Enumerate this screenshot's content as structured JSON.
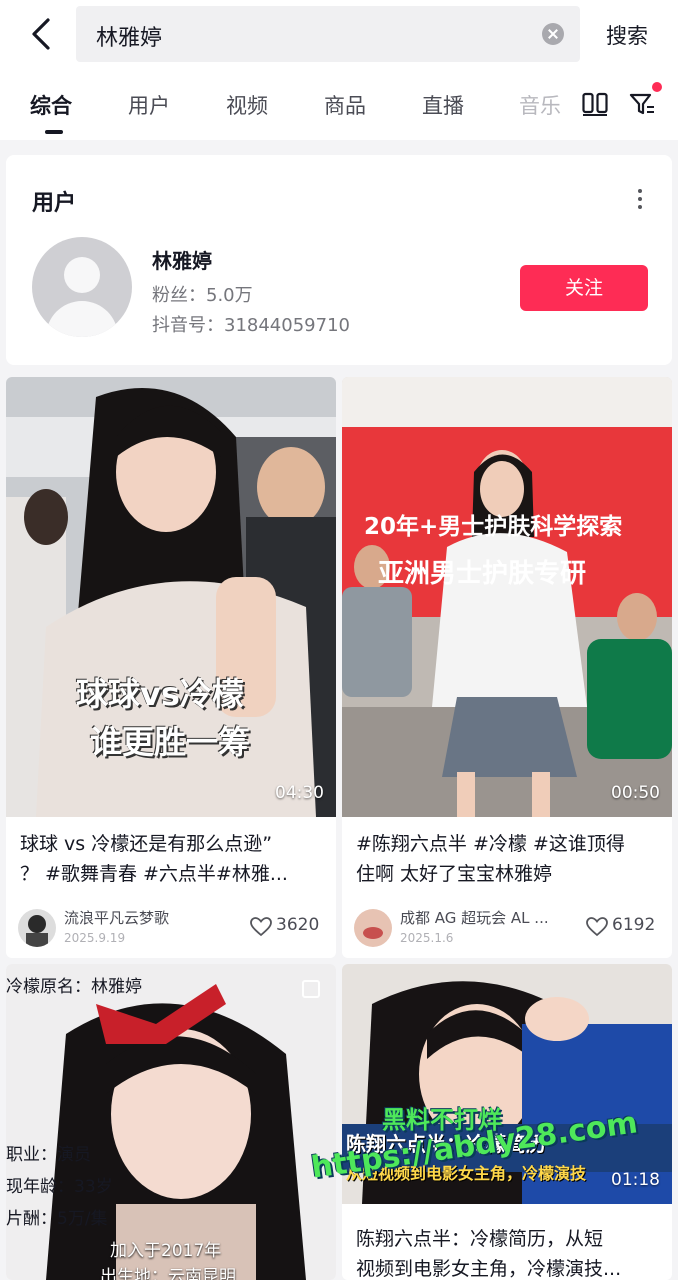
{
  "search": {
    "query": "林雅婷",
    "button_label": "搜索"
  },
  "tabs": [
    {
      "label": "综合"
    },
    {
      "label": "用户"
    },
    {
      "label": "视频"
    },
    {
      "label": "商品"
    },
    {
      "label": "直播"
    },
    {
      "label": "音乐"
    }
  ],
  "user_section": {
    "title": "用户",
    "name": "林雅婷",
    "fans": "粉丝：5.0万",
    "douyin_id": "抖音号：31844059710",
    "follow_label": "关注"
  },
  "videos": [
    {
      "overlay_line1": "球球vs冷檬",
      "overlay_line2": "谁更胜一筹",
      "duration": "04:30",
      "caption_line1": "球球 vs 冷檬还是有那么点逊”",
      "caption_line2": "？ #歌舞青春 #六点半#林雅...",
      "author": "流浪平凡云梦歌",
      "date": "2025.9.19",
      "likes": "3620"
    },
    {
      "banner_line1": "20年+男士护肤科学探索",
      "banner_line2": "亚洲男士护肤专研",
      "duration": "00:50",
      "caption_line1": "#陈翔六点半 #冷檬 #这谁顶得",
      "caption_line2": "住啊 太好了宝宝林雅婷",
      "author": "成都 AG 超玩会 AL ...",
      "date": "2025.1.6",
      "likes": "6192"
    },
    {
      "overlay_title": "冷檬原名：林雅婷",
      "overlay_job": "职业：演员",
      "overlay_age": "现年龄：33岁",
      "overlay_pay": "片酬：5万/集",
      "overlay_join": "加入于2017年",
      "overlay_birth": "出生地：云南昆明"
    },
    {
      "overlay_top": "陈翔六点半：冷檬简历",
      "overlay_bottom": "从短视频到电影女主角，冷檬演技",
      "duration": "01:18",
      "caption_line1": "陈翔六点半：冷檬简历，从短",
      "caption_line2": "视频到电影女主角，冷檬演技..."
    }
  ],
  "watermark": {
    "line1": "黑料不打烊",
    "line2": "https://abdy28.com"
  },
  "colors": {
    "accent": "#fe2c55",
    "text": "#161823",
    "muted": "#75767c"
  }
}
